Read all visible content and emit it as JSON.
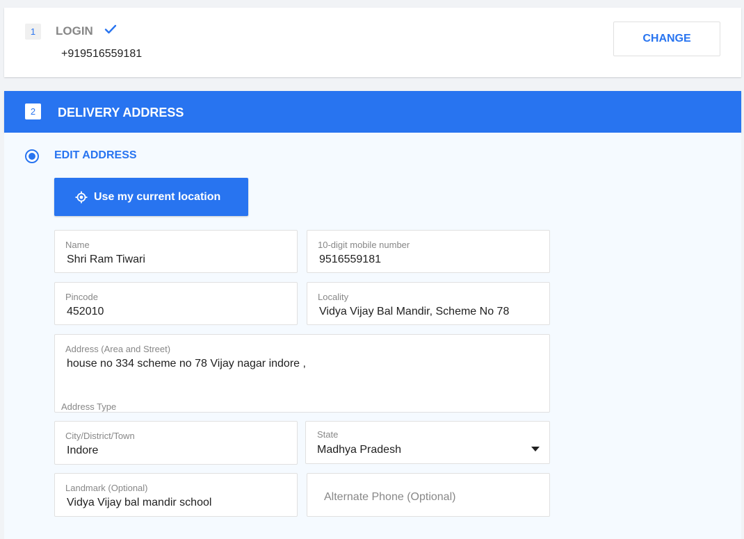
{
  "login": {
    "step": "1",
    "title": "LOGIN",
    "phone": "+919516559181",
    "change_label": "CHANGE"
  },
  "delivery": {
    "step": "2",
    "title": "DELIVERY ADDRESS",
    "edit_label": "EDIT ADDRESS",
    "location_button": "Use my current location",
    "fields": {
      "name": {
        "label": "Name",
        "value": "Shri Ram Tiwari"
      },
      "mobile": {
        "label": "10-digit mobile number",
        "value": "9516559181"
      },
      "pincode": {
        "label": "Pincode",
        "value": "452010"
      },
      "locality": {
        "label": "Locality",
        "value": "Vidya Vijay Bal Mandir, Scheme No 78"
      },
      "address": {
        "label": "Address (Area and Street)",
        "value": "house no 334 scheme no 78 Vijay nagar indore ,"
      },
      "city": {
        "label": "City/District/Town",
        "value": "Indore"
      },
      "state": {
        "label": "State",
        "value": "Madhya Pradesh"
      },
      "landmark": {
        "label": "Landmark (Optional)",
        "value": "Vidya Vijay bal mandir school"
      },
      "alt_phone": {
        "placeholder": "Alternate Phone (Optional)"
      }
    },
    "address_type_label": "Address Type"
  },
  "colors": {
    "accent": "#2874f0",
    "muted": "#878787",
    "text": "#212121"
  }
}
